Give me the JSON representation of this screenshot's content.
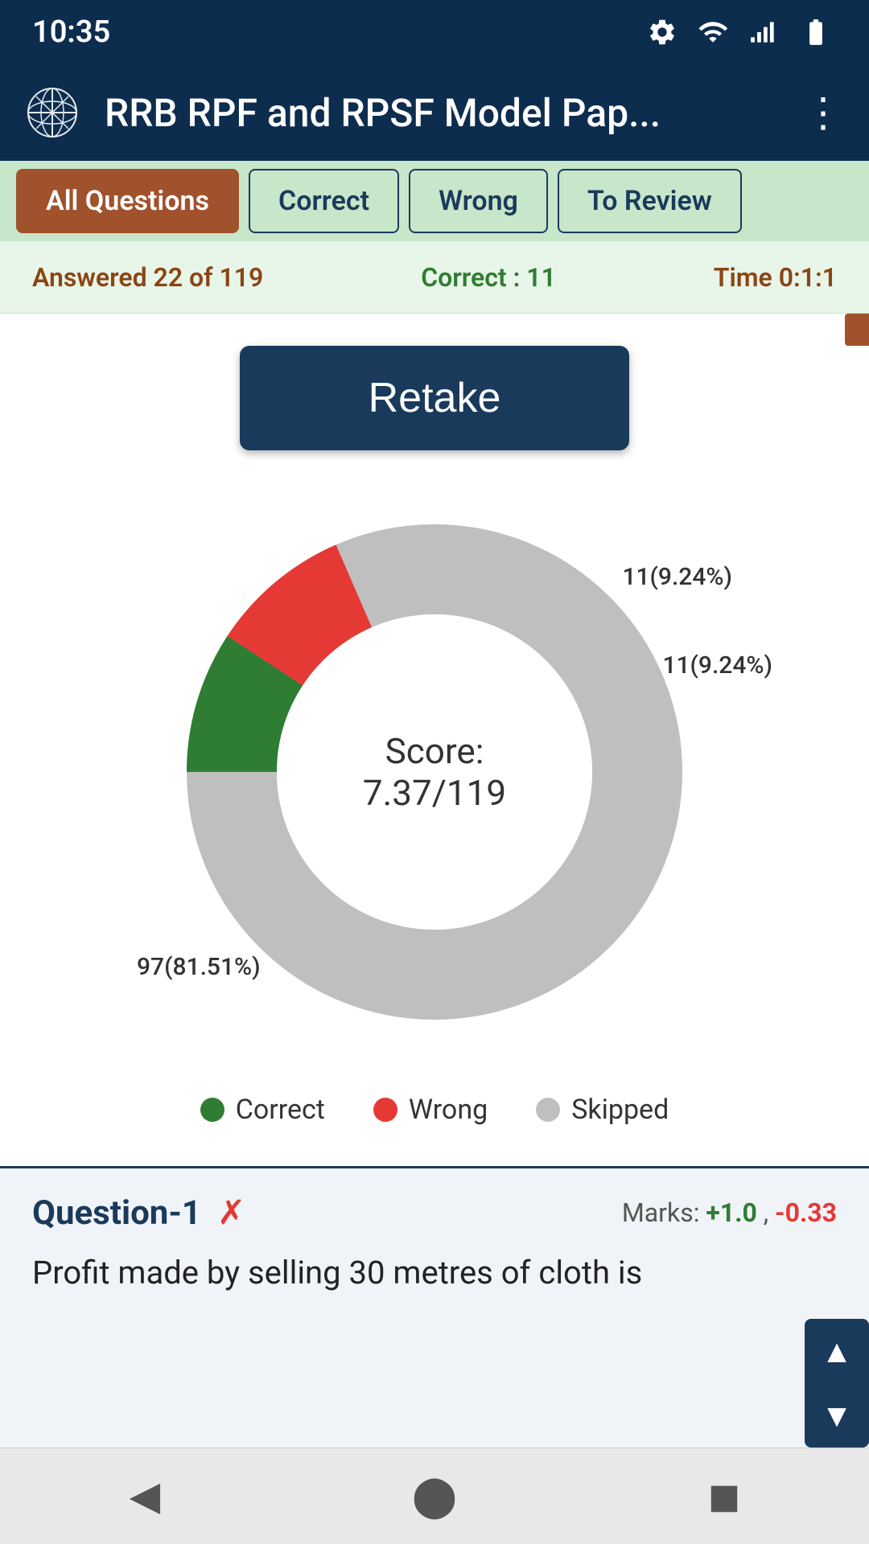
{
  "statusBar": {
    "time": "10:35"
  },
  "appBar": {
    "title": "RRB RPF and RPSF Model Pap...",
    "moreLabel": "⋮"
  },
  "tabs": [
    {
      "id": "all",
      "label": "All Questions",
      "active": true
    },
    {
      "id": "correct",
      "label": "Correct",
      "active": false
    },
    {
      "id": "wrong",
      "label": "Wrong",
      "active": false
    },
    {
      "id": "review",
      "label": "To Review",
      "active": false
    }
  ],
  "statsBar": {
    "answered": "Answered 22 of 119",
    "correct": "Correct : 11",
    "time": "Time 0:1:1"
  },
  "retakeButton": {
    "label": "Retake"
  },
  "chart": {
    "scoreLabel": "Score:",
    "scoreValue": "7.37/119",
    "correctPercent": "11(9.24%)",
    "wrongPercent": "11(9.24%)",
    "skippedPercent": "97(81.51%)",
    "correctValue": 11,
    "wrongValue": 11,
    "skippedValue": 97,
    "totalValue": 119
  },
  "legend": {
    "correct": "Correct",
    "wrong": "Wrong",
    "skipped": "Skipped"
  },
  "questionCard": {
    "label": "Question-1",
    "marksLabel": "Marks: ",
    "marksPositive": "+1.0",
    "marksSeparator": " , ",
    "marksNegative": "-0.33",
    "questionText": "Profit made by selling 30 metres of cloth is"
  }
}
